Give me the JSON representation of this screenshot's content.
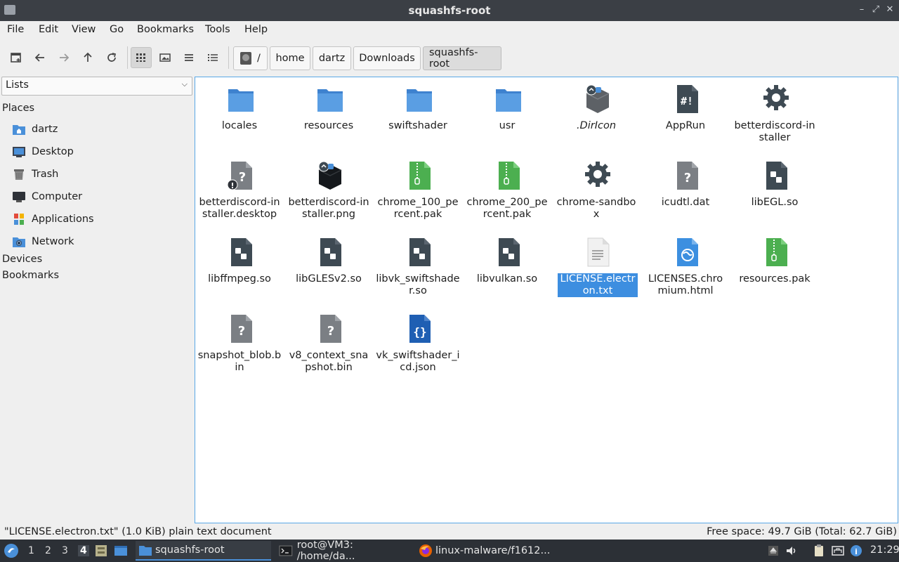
{
  "window": {
    "title": "squashfs-root",
    "controls": [
      "minimize-icon",
      "restore-icon",
      "close-icon"
    ]
  },
  "menu": [
    "File",
    "Edit",
    "View",
    "Go",
    "Bookmarks",
    "Tools",
    "Help"
  ],
  "breadcrumb": {
    "root": "/",
    "parts": [
      "home",
      "dartz",
      "Downloads",
      "squashfs-root"
    ]
  },
  "sidebar": {
    "mode": "Lists",
    "places_heading": "Places",
    "places": [
      {
        "label": "dartz",
        "icon": "home-folder-icon"
      },
      {
        "label": "Desktop",
        "icon": "desktop-icon"
      },
      {
        "label": "Trash",
        "icon": "trash-icon"
      },
      {
        "label": "Computer",
        "icon": "computer-icon"
      },
      {
        "label": "Applications",
        "icon": "applications-icon"
      },
      {
        "label": "Network",
        "icon": "network-icon"
      }
    ],
    "devices_heading": "Devices",
    "bookmarks_heading": "Bookmarks"
  },
  "files": [
    {
      "name": "locales",
      "icon": "folder-icon"
    },
    {
      "name": "resources",
      "icon": "folder-icon"
    },
    {
      "name": "swiftshader",
      "icon": "folder-icon"
    },
    {
      "name": "usr",
      "icon": "folder-icon"
    },
    {
      "name": ".DirIcon",
      "icon": "image-link-icon"
    },
    {
      "name": "AppRun",
      "icon": "script-icon"
    },
    {
      "name": "betterdiscord-installer",
      "icon": "gear-icon"
    },
    {
      "name": "betterdiscord-installer.desktop",
      "icon": "unknown-warning-icon"
    },
    {
      "name": "betterdiscord-installer.png",
      "icon": "image-link-icon"
    },
    {
      "name": "chrome_100_percent.pak",
      "icon": "archive-icon"
    },
    {
      "name": "chrome_200_percent.pak",
      "icon": "archive-icon"
    },
    {
      "name": "chrome-sandbox",
      "icon": "gear-icon"
    },
    {
      "name": "icudtl.dat",
      "icon": "unknown-icon"
    },
    {
      "name": "libEGL.so",
      "icon": "library-icon"
    },
    {
      "name": "libffmpeg.so",
      "icon": "library-icon"
    },
    {
      "name": "libGLESv2.so",
      "icon": "library-icon"
    },
    {
      "name": "libvk_swiftshader.so",
      "icon": "library-icon"
    },
    {
      "name": "libvulkan.so",
      "icon": "library-icon"
    },
    {
      "name": "LICENSE.electron.txt",
      "icon": "text-file-icon"
    },
    {
      "name": "LICENSES.chromium.html",
      "icon": "html-icon"
    },
    {
      "name": "resources.pak",
      "icon": "archive-icon"
    },
    {
      "name": "snapshot_blob.bin",
      "icon": "unknown-icon"
    },
    {
      "name": "v8_context_snapshot.bin",
      "icon": "unknown-icon"
    },
    {
      "name": "vk_swiftshader_icd.json",
      "icon": "json-icon"
    }
  ],
  "selected_file": "LICENSE.electron.txt",
  "status": {
    "left": "\"LICENSE.electron.txt\" (1.0 KiB) plain text document",
    "right": "Free space: 49.7 GiB (Total: 62.7 GiB)"
  },
  "taskbar": {
    "workspaces": [
      "1",
      "2",
      "3",
      "4"
    ],
    "current_workspace": "4",
    "tasks": [
      {
        "label": "squashfs-root",
        "icon": "folder-icon"
      },
      {
        "label": "root@VM3: /home/da...",
        "icon": "terminal-icon"
      },
      {
        "label": "linux-malware/f1612...",
        "icon": "firefox-icon"
      }
    ],
    "clock": "21:29"
  },
  "colors": {
    "folder": "#4a90d9",
    "selection": "#3d8ee0",
    "archive": "#4caf50",
    "library": "#3e4a53"
  }
}
